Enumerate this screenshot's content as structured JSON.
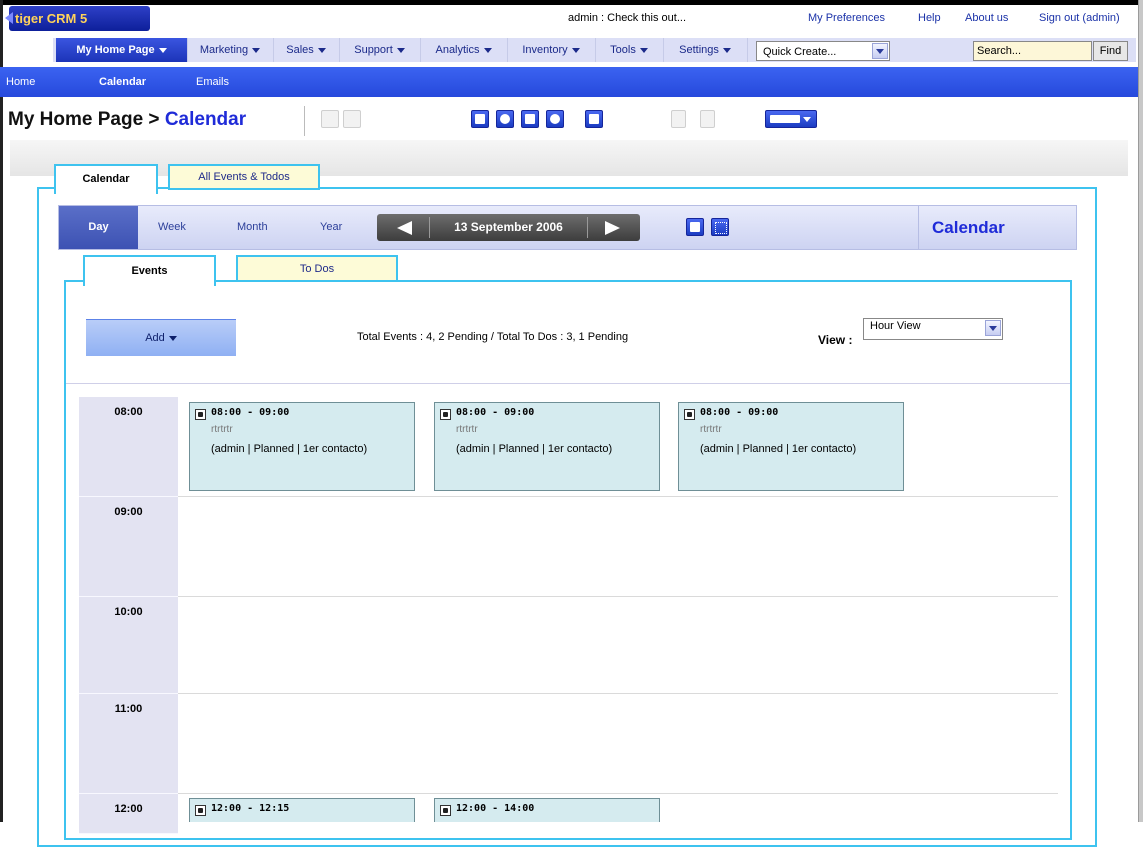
{
  "app": {
    "logo_text": "tiger CRM 5"
  },
  "header": {
    "admin_message": "admin : Check this out...",
    "links": {
      "preferences": "My Preferences",
      "help": "Help",
      "about": "About us",
      "signout": "Sign out (admin)"
    }
  },
  "main_menu": {
    "items": [
      {
        "label": "My Home Page",
        "active": true
      },
      {
        "label": "Marketing"
      },
      {
        "label": "Sales"
      },
      {
        "label": "Support"
      },
      {
        "label": "Analytics"
      },
      {
        "label": "Inventory"
      },
      {
        "label": "Tools"
      },
      {
        "label": "Settings"
      }
    ],
    "quick_create": "Quick Create...",
    "search_value": "Search...",
    "find_label": "Find"
  },
  "sub_menu": {
    "items": [
      "Home",
      "Calendar",
      "Emails"
    ]
  },
  "page": {
    "title_prefix": "My Home Page > ",
    "title_current": "Calendar"
  },
  "tabs": {
    "calendar": "Calendar",
    "all_events": "All Events & Todos"
  },
  "view_bar": {
    "day": "Day",
    "week": "Week",
    "month": "Month",
    "year": "Year",
    "date": "13 September 2006",
    "title": "Calendar"
  },
  "inner_tabs": {
    "events": "Events",
    "todos": "To Dos"
  },
  "controls": {
    "add_label": "Add",
    "totals": "Total Events : 4, 2 Pending / Total To Dos : 3, 1 Pending",
    "view_label": "View :",
    "view_value": "Hour View"
  },
  "schedule": {
    "hours": [
      "08:00",
      "09:00",
      "10:00",
      "11:00",
      "12:00"
    ],
    "events": [
      {
        "icon": "phone-icon",
        "time": "08:00 - 09:00",
        "subject": "rtrtrtr",
        "detail": "(admin | Planned | 1er contacto)"
      },
      {
        "icon": "phone-icon",
        "time": "08:00 - 09:00",
        "subject": "rtrtrtr",
        "detail": "(admin | Planned | 1er contacto)"
      },
      {
        "icon": "phone-icon",
        "time": "08:00 - 09:00",
        "subject": "rtrtrtr",
        "detail": "(admin | Planned | 1er contacto)"
      },
      {
        "icon": "phone-icon",
        "time": "12:00 - 12:15",
        "subject": "",
        "detail": ""
      },
      {
        "icon": "meeting-icon",
        "time": "12:00 - 14:00",
        "subject": "",
        "detail": ""
      }
    ]
  },
  "colors": {
    "accent": "#2649dc",
    "tab_border": "#3ec3ef",
    "event_bg": "#d5ebef",
    "title_blue": "#1f2bd8"
  }
}
